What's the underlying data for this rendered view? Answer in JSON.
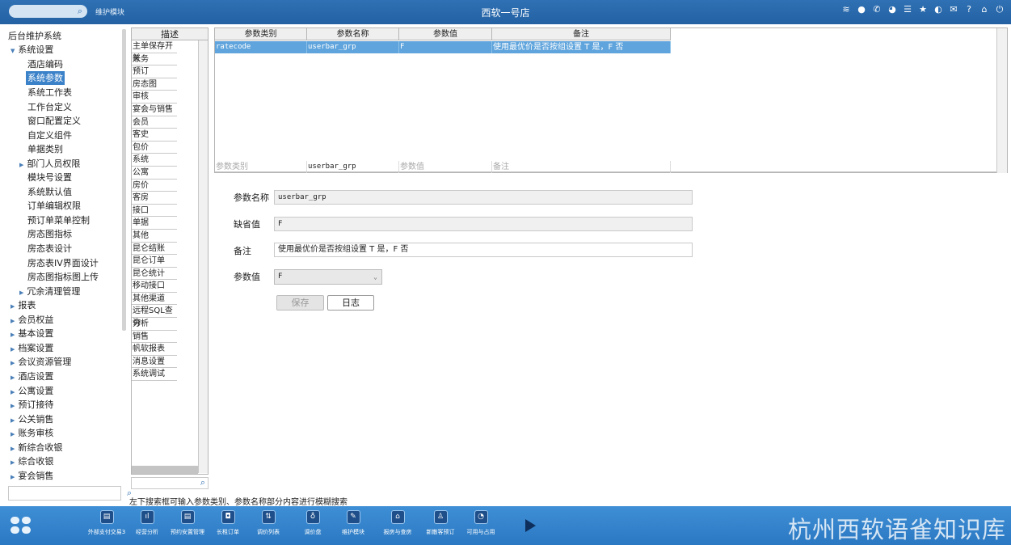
{
  "topbar": {
    "breadcrumb": "维护模块",
    "title": "西软一号店",
    "icons": [
      "wifi-icon",
      "dot-icon",
      "phone-icon",
      "chat-icon",
      "menu-icon",
      "star-icon",
      "moon-icon",
      "mail-icon",
      "help-icon",
      "home-icon",
      "power-icon"
    ]
  },
  "tree": {
    "root": "后台维护系统",
    "system_settings": "系统设置",
    "items": [
      "酒店编码",
      "系统参数",
      "系统工作表",
      "工作台定义",
      "窗口配置定义",
      "自定义组件",
      "单据类别"
    ],
    "dept_perms": "部门人员权限",
    "items2": [
      "模块号设置",
      "系统默认值",
      "订单编辑权限",
      "预订单菜单控制",
      "房态图指标",
      "房态表设计",
      "房态表IV界面设计",
      "房态图指标图上传"
    ],
    "cleanup": "冗余清理管理",
    "groups": [
      "报表",
      "会员权益",
      "基本设置",
      "档案设置",
      "会议资源管理",
      "酒店设置",
      "公寓设置",
      "预订接待",
      "公关销售",
      "账务审核",
      "新综合收银",
      "综合收银",
      "宴会销售"
    ]
  },
  "desc_panel": {
    "header": "描述",
    "rows": [
      "主单保存开关",
      "账务",
      "预订",
      "房态图",
      "审核",
      "宴会与销售",
      "会员",
      "客史",
      "包价",
      "系统",
      "公寓",
      "房价",
      "客房",
      "接口",
      "单据",
      "其他",
      "昆仑结账",
      "昆仑订单",
      "昆仑统计",
      "移动接口",
      "其他渠道",
      "远程SQL查询",
      "分析",
      "销售",
      "帆软报表",
      "消息设置",
      "系统调试"
    ]
  },
  "grid": {
    "columns": [
      "参数类别",
      "参数名称",
      "参数值",
      "备注"
    ],
    "row": {
      "category": "ratecode",
      "name": "userbar_grp",
      "value": "F",
      "note": "使用最优价是否按组设置 T 是，F 否"
    },
    "filter": {
      "category_placeholder": "参数类别",
      "name_value": "userbar_grp",
      "value_placeholder": "参数值",
      "note_placeholder": "备注"
    }
  },
  "form": {
    "name_label": "参数名称",
    "name_value": "userbar_grp",
    "default_label": "缺省值",
    "default_value": "F",
    "note_label": "备注",
    "note_value": "使用最优价是否按组设置 T 是，F 否",
    "param_label": "参数值",
    "param_value": "F",
    "save_label": "保存",
    "log_label": "日志"
  },
  "hint": "左下搜索框可输入参数类别、参数名称部分内容进行模糊搜索",
  "taskbar": {
    "items": [
      {
        "label": "外部支付交易3",
        "icon": "▤"
      },
      {
        "label": "经营分析",
        "icon": "ıl"
      },
      {
        "label": "预约安置管理",
        "icon": "▤"
      },
      {
        "label": "长租订单",
        "icon": "◘"
      },
      {
        "label": "调价列表",
        "icon": "⇅"
      },
      {
        "label": "调价盘",
        "icon": "♁"
      },
      {
        "label": "维护模块",
        "icon": "✎"
      },
      {
        "label": "报房与查房",
        "icon": "⌂"
      },
      {
        "label": "新散客预订",
        "icon": "♙"
      },
      {
        "label": "可用与占用",
        "icon": "◔"
      }
    ],
    "brand": "杭州西软语雀知识库"
  }
}
